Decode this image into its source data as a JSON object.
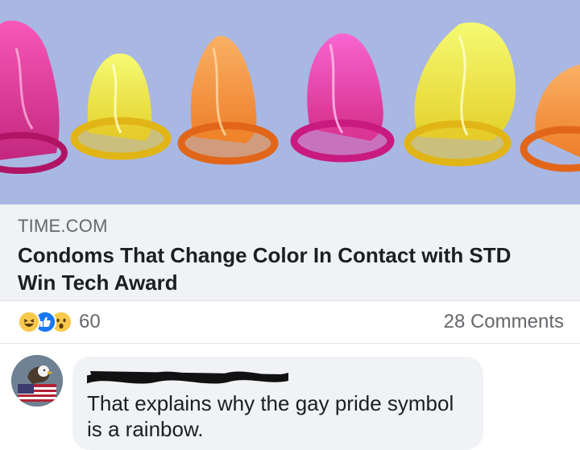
{
  "link_preview": {
    "image_description_icons": [
      "condom-pink-icon",
      "condom-yellow-icon",
      "condom-orange-icon",
      "condom-magenta-icon",
      "condom-yellow-icon",
      "condom-orange-icon"
    ],
    "domain": "TIME.COM",
    "headline": "Condoms That Change Color In Contact with STD Win Tech Award"
  },
  "stats": {
    "reactions": [
      "haha-reaction-icon",
      "like-reaction-icon",
      "wow-reaction-icon"
    ],
    "reaction_count": "60",
    "comments_label": "28 Comments"
  },
  "comment": {
    "author": "",
    "text": "That explains why the gay pride symbol is a rainbow."
  },
  "colors": {
    "image_bg": "#a9b7e3",
    "meta_bg": "#f0f2f5",
    "like_blue": "#1877f2",
    "emoji_yellow": "#f7c94c"
  }
}
